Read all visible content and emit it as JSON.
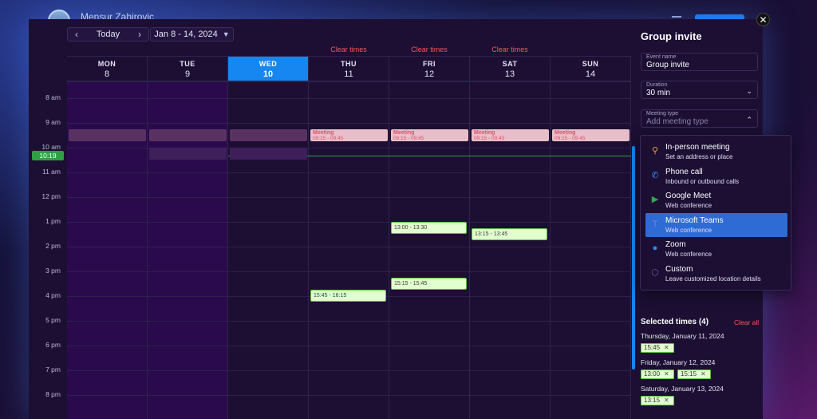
{
  "user": {
    "name": "Mensur Zahirovic"
  },
  "toolbar": {
    "today_label": "Today",
    "prev": "‹",
    "next": "›",
    "range": "Jan 8 - 14, 2024"
  },
  "clear_times_label": "Clear times",
  "days": [
    {
      "name": "MON",
      "date": "8"
    },
    {
      "name": "TUE",
      "date": "9"
    },
    {
      "name": "WED",
      "date": "10",
      "active": true
    },
    {
      "name": "THU",
      "date": "11"
    },
    {
      "name": "FRI",
      "date": "12"
    },
    {
      "name": "SAT",
      "date": "13"
    },
    {
      "name": "SUN",
      "date": "14"
    }
  ],
  "hours": [
    "8 am",
    "9 am",
    "10 am",
    "11 am",
    "12 pm",
    "1 pm",
    "2 pm",
    "3 pm",
    "4 pm",
    "5 pm",
    "6 pm",
    "7 pm",
    "8 pm"
  ],
  "now_label": "10:19",
  "meeting": {
    "title": "Meeting",
    "time": "09:15 - 09:45"
  },
  "slots": [
    {
      "label": "13:00 - 13:30"
    },
    {
      "label": "13:15 - 13:45"
    },
    {
      "label": "15:15 - 15:45"
    },
    {
      "label": "15:45 - 16:15"
    }
  ],
  "panel": {
    "title": "Group invite",
    "event_name_label": "Event name",
    "event_name_value": "Group invite",
    "duration_label": "Duration",
    "duration_value": "30 min",
    "meeting_type_label": "Meeting type",
    "meeting_type_placeholder": "Add meeting type"
  },
  "meeting_types": [
    {
      "title": "In-person meeting",
      "sub": "Set an address or place",
      "icon": "map-pin-icon",
      "glyph": "⚲",
      "color": "#f0a030"
    },
    {
      "title": "Phone call",
      "sub": "Inbound or outbound calls",
      "icon": "phone-icon",
      "glyph": "✆",
      "color": "#3a8af0"
    },
    {
      "title": "Google Meet",
      "sub": "Web conference",
      "icon": "google-meet-icon",
      "glyph": "▶",
      "color": "#34a853"
    },
    {
      "title": "Microsoft Teams",
      "sub": "Web conference",
      "icon": "teams-icon",
      "glyph": "T",
      "color": "#7b83eb",
      "selected": true
    },
    {
      "title": "Zoom",
      "sub": "Web conference",
      "icon": "zoom-icon",
      "glyph": "●",
      "color": "#2d8cff"
    },
    {
      "title": "Custom",
      "sub": "Leave customized location details",
      "icon": "custom-icon",
      "glyph": "⬡",
      "color": "#6a5aa8"
    }
  ],
  "selected": {
    "title": "Selected times (4)",
    "clear_all": "Clear all",
    "groups": [
      {
        "date": "Thursday, January 11, 2024",
        "times": [
          "15:45"
        ]
      },
      {
        "date": "Friday, January 12, 2024",
        "times": [
          "13:00",
          "15:15"
        ]
      },
      {
        "date": "Saturday, January 13, 2024",
        "times": [
          "13:15"
        ]
      }
    ]
  },
  "close_glyph": "✕",
  "chip_close": "✕"
}
